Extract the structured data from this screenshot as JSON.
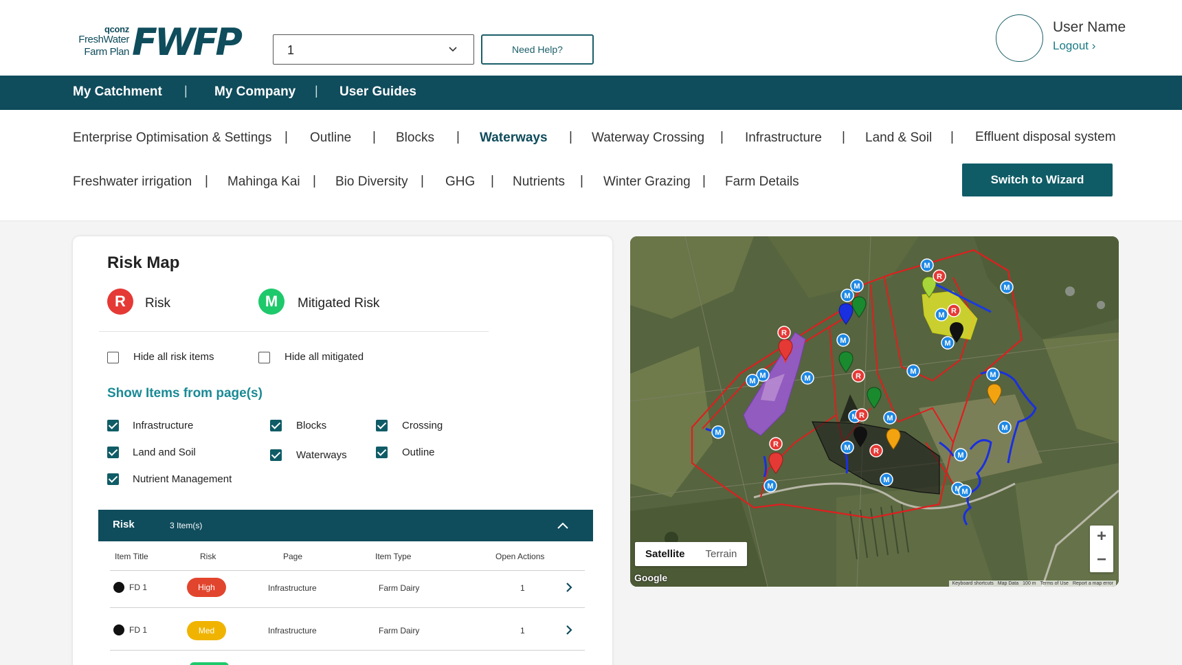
{
  "header": {
    "logo_brand": "qconz",
    "logo_line1": "FreshWater",
    "logo_line2": "Farm Plan",
    "logo_mark": "FWFP",
    "farm_select_value": "1",
    "help_label": "Need Help?",
    "user_name": "User Name",
    "logout_label": "Logout ›"
  },
  "main_nav": {
    "items": [
      "My Catchment",
      "My Company",
      "User Guides"
    ],
    "separator": "|"
  },
  "sub_nav": {
    "row1": [
      "Enterprise Optimisation & Settings",
      "Outline",
      "Blocks",
      "Waterways",
      "Waterway Crossing",
      "Infrastructure",
      "Land & Soil",
      "Effluent disposal system"
    ],
    "row2": [
      "Freshwater irrigation",
      "Mahinga Kai",
      "Bio Diversity",
      "GHG",
      "Nutrients",
      "Winter Grazing",
      "Farm Details"
    ],
    "active": "Waterways",
    "separator": "|",
    "wizard_label": "Switch to Wizard"
  },
  "risk_panel": {
    "title": "Risk Map",
    "legend": [
      {
        "badge": "R",
        "label": "Risk",
        "color": "#e53935"
      },
      {
        "badge": "M",
        "label": "Mitigated Risk",
        "color": "#1ec96b"
      }
    ],
    "hide_risk_label": "Hide all risk items",
    "hide_mitigated_label": "Hide all mitigated",
    "show_items_label": "Show Items from page(s)",
    "page_filters": {
      "infrastructure": "Infrastructure",
      "blocks": "Blocks",
      "crossing": "Crossing",
      "land_soil": "Land and Soil",
      "waterways": "Waterways",
      "outline": "Outline",
      "nutrient": "Nutrient Management"
    },
    "risk_section": {
      "title": "Risk",
      "count": "3 Item(s)"
    },
    "table": {
      "headers": [
        "Item Title",
        "Risk",
        "Page",
        "Item Type",
        "Open Actions"
      ],
      "rows": [
        {
          "title": "FD 1",
          "risk": "High",
          "risk_color": "#e2452d",
          "page": "Infrastructure",
          "type": "Farm Dairy",
          "actions": "1"
        },
        {
          "title": "FD 1",
          "risk": "Med",
          "risk_color": "#f0b400",
          "page": "Infrastructure",
          "type": "Farm Dairy",
          "actions": "1"
        }
      ]
    }
  },
  "map": {
    "type_satellite": "Satellite",
    "type_terrain": "Terrain",
    "zoom_in": "+",
    "zoom_out": "−",
    "google_label": "Google",
    "attribution": [
      "Keyboard shortcuts",
      "Map Data",
      "100 m",
      "Terms of Use",
      "Report a map error"
    ],
    "marker_labels": {
      "risk": "R",
      "mitigated": "M"
    }
  },
  "colors": {
    "primary": "#0f4c5c",
    "accent": "#1a8a95",
    "risk": "#e53935",
    "mitigated_map": "#1e88e5"
  }
}
